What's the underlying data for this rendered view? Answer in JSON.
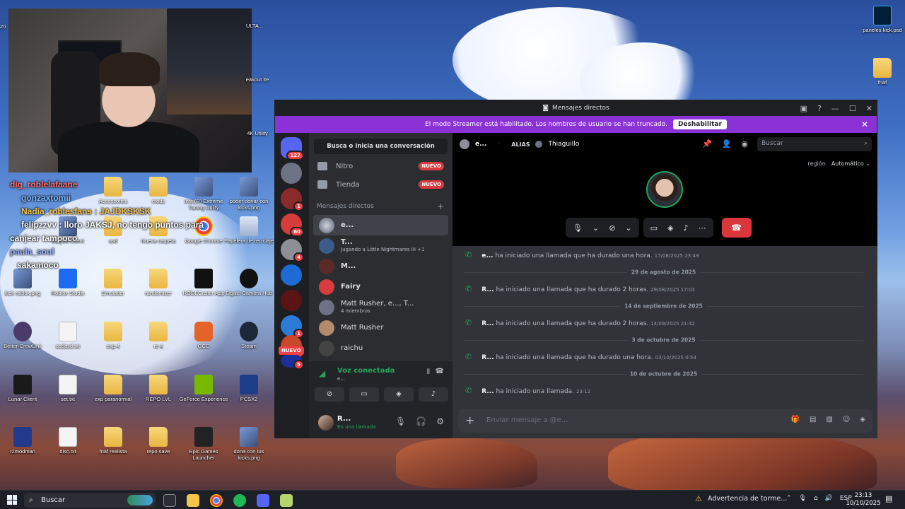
{
  "desktop": {
    "top_left_label": "20",
    "icons": [
      {
        "label": "Accessories",
        "kind": "folder"
      },
      {
        "label": "mods",
        "kind": "folder"
      },
      {
        "label": "Intel(R) Extreme Tuning Utility",
        "kind": "img"
      },
      {
        "label": "poder donar con kicks.png",
        "kind": "img"
      },
      {
        "label": "Eclipse Client",
        "kind": "img"
      },
      {
        "label": "asd",
        "kind": "folder"
      },
      {
        "label": "Nueva carpeta",
        "kind": "folder"
      },
      {
        "label": "Google Chrome",
        "kind": "img"
      },
      {
        "label": "Papelera de reciclaje",
        "kind": "img"
      },
      {
        "label": "kick roblox.png",
        "kind": "img"
      },
      {
        "label": "Roblox Studio",
        "kind": "img"
      },
      {
        "label": "Emulador",
        "kind": "folder"
      },
      {
        "label": "randomizer",
        "kind": "folder"
      },
      {
        "label": "RØDECaster App",
        "kind": "img"
      },
      {
        "label": "Elgato Camera Hub",
        "kind": "img"
      },
      {
        "label": "Better-CrewLink",
        "kind": "img"
      },
      {
        "label": "asdasd.txt",
        "kind": "doc"
      },
      {
        "label": "exp 4",
        "kind": "folder"
      },
      {
        "label": "re 4",
        "kind": "folder"
      },
      {
        "label": "GCC",
        "kind": "img"
      },
      {
        "label": "Steam",
        "kind": "img"
      },
      {
        "label": "Lunar Client",
        "kind": "img"
      },
      {
        "label": "set.txt",
        "kind": "doc"
      },
      {
        "label": "exp paranormal",
        "kind": "folder"
      },
      {
        "label": "REPO LVL",
        "kind": "folder"
      },
      {
        "label": "GeForce Experience",
        "kind": "img"
      },
      {
        "label": "PCSX2",
        "kind": "img"
      },
      {
        "label": "r2modman",
        "kind": "img"
      },
      {
        "label": "disc.txt",
        "kind": "doc"
      },
      {
        "label": "fnaf realista",
        "kind": "folder"
      },
      {
        "label": "repo save",
        "kind": "folder"
      },
      {
        "label": "Epic Games Launcher",
        "kind": "img"
      },
      {
        "label": "dona con tus kicks.png",
        "kind": "img"
      },
      {
        "label": "paneles kick.psd",
        "kind": "img"
      },
      {
        "label": "fnaf",
        "kind": "folder"
      },
      {
        "label": "ULTA...",
        "kind": "img"
      },
      {
        "label": "eakout ite",
        "kind": "img"
      },
      {
        "label": "4K Utility",
        "kind": "img"
      }
    ]
  },
  "overlay_chat": [
    "dig_roblelafaane",
    "gonzaxtomii",
    "Nadia_roblesfans : JAJDKSKSK",
    "felipzzvv : lloro JAKSJ, no tengo puntos para",
    "canjear tampoco",
    "paula_soul",
    "sakamoco"
  ],
  "discord": {
    "title": "Mensajes directos",
    "banner": {
      "text": "El modo Streamer está habilitado. Los nombres de usuario se han truncado.",
      "button": "Deshabilitar"
    },
    "guild_badges": [
      "127",
      "1",
      "60",
      "4",
      "1",
      "10",
      "5"
    ],
    "guild_new": "NUEVO",
    "search_conv": "Busca o inicia una conversación",
    "nav": [
      {
        "label": "Nitro",
        "badge": "NUEVO"
      },
      {
        "label": "Tienda",
        "badge": "NUEVO"
      }
    ],
    "dm_header": "Mensajes directos",
    "dm_add": "+",
    "dms": [
      {
        "name": "e...",
        "sub": ""
      },
      {
        "name": "T...",
        "sub": "Jugando a Little Nightmares III +1"
      },
      {
        "name": "M...",
        "sub": ""
      },
      {
        "name": "Fairy",
        "sub": ""
      },
      {
        "name": "Matt Rusher, e..., T...",
        "sub": "4 miembros"
      },
      {
        "name": "Matt Rusher",
        "sub": ""
      },
      {
        "name": "raichu",
        "sub": ""
      }
    ],
    "voice": {
      "title": "Voz conectada",
      "sub": "e..."
    },
    "user": {
      "name": "R...",
      "status": "En una llamada"
    },
    "header": {
      "user": "e...",
      "alias_label": "ALIAS",
      "alias": "Thiaguillo",
      "search_placeholder": "Buscar"
    },
    "region": {
      "label": "región",
      "value": "Automático"
    },
    "messages": [
      {
        "who": "e...",
        "text": "ha iniciado una llamada que ha durado una hora.",
        "ts": "17/08/2025 23:49"
      },
      {
        "divider": "29 de agosto de 2025"
      },
      {
        "who": "R...",
        "text": "ha iniciado una llamada que ha durado 2 horas.",
        "ts": "29/08/2025 17:03"
      },
      {
        "divider": "14 de septiembre de 2025"
      },
      {
        "who": "R...",
        "text": "ha iniciado una llamada que ha durado 2 horas.",
        "ts": "14/09/2025 21:42"
      },
      {
        "divider": "3 de octubre de 2025"
      },
      {
        "who": "R...",
        "text": "ha iniciado una llamada que ha durado una hora.",
        "ts": "03/10/2025 0:54"
      },
      {
        "divider": "10 de octubre de 2025"
      },
      {
        "who": "R...",
        "text": "ha iniciado una llamada.",
        "ts": "23:12"
      }
    ],
    "composer_placeholder": "Enviar mensaje a @e..."
  },
  "taskbar": {
    "search": "Buscar",
    "warning": "Advertencia de torme...",
    "lang": "ESP",
    "time": "23:13",
    "date": "10/10/2025"
  },
  "colors": {
    "discord_bg": "#313338",
    "banner": "#8a32d6",
    "online_green": "#23a55a",
    "hangup_red": "#da373c"
  }
}
